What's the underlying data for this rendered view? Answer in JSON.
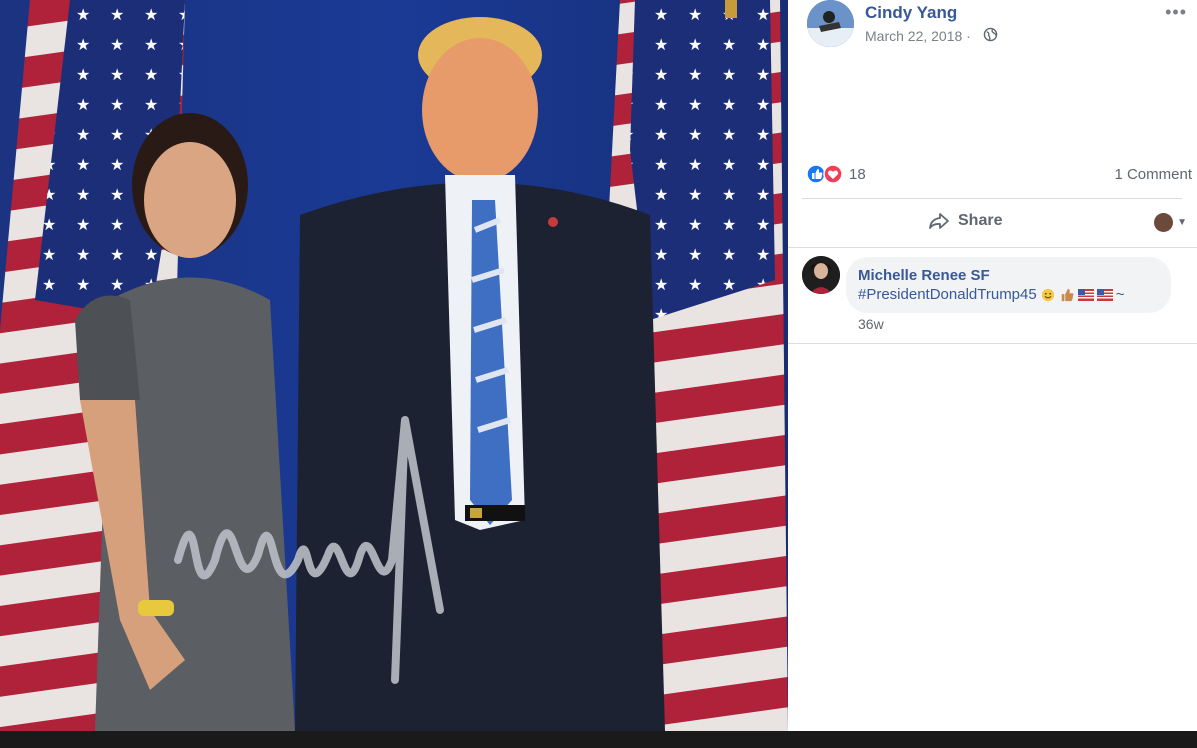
{
  "post": {
    "author": "Cindy Yang",
    "date": "March 22, 2018 ·",
    "more_label": "•••"
  },
  "stats": {
    "reaction_count": "18",
    "comment_count": "1 Comment",
    "reactions": [
      "like-icon",
      "love-icon"
    ]
  },
  "actions": {
    "share_label": "Share",
    "audience_caret": "▼"
  },
  "comment": {
    "author": "Michelle Renee SF",
    "text": "#PresidentDonaldTrump45",
    "emojis": [
      "grinning-face",
      "thumbs-up",
      "us-flag",
      "us-flag"
    ],
    "trailing": "~",
    "time": "36w"
  },
  "colors": {
    "link_blue": "#385898",
    "meta_gray": "#606770",
    "divider": "#dadde1",
    "bubble_bg": "#f2f3f5",
    "photo_backdrop": "#16307a",
    "flag_red": "#b0213a"
  }
}
